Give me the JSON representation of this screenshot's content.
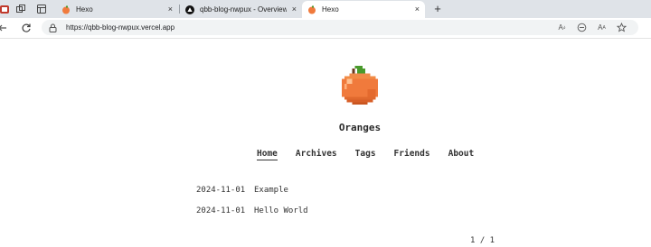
{
  "browser": {
    "tabs": [
      {
        "title": "Hexo",
        "active": false
      },
      {
        "title": "qbb-blog-nwpux - Overview – Ve",
        "active": false
      },
      {
        "title": "Hexo",
        "active": true
      }
    ],
    "new_tab_label": "+",
    "close_glyph": "×",
    "address": "https://qbb-blog-nwpux.vercel.app",
    "omnibox_icons": [
      "read-aloud-icon",
      "translate-icon",
      "text-size-icon",
      "favorite-star-icon"
    ]
  },
  "site": {
    "title": "Oranges",
    "logo": "orange-pixel-logo",
    "nav": [
      {
        "label": "Home",
        "current": true
      },
      {
        "label": "Archives",
        "current": false
      },
      {
        "label": "Tags",
        "current": false
      },
      {
        "label": "Friends",
        "current": false
      },
      {
        "label": "About",
        "current": false
      }
    ],
    "posts": [
      {
        "date": "2024-11-01",
        "title": "Example"
      },
      {
        "date": "2024-11-01",
        "title": "Hello World"
      }
    ],
    "pagination": "1 / 1"
  },
  "colors": {
    "tabstrip_bg": "#dfe3e8",
    "omnibox_bg": "#f1f3f4",
    "orange": "#f07a3c",
    "leaf": "#4a9a2c"
  }
}
